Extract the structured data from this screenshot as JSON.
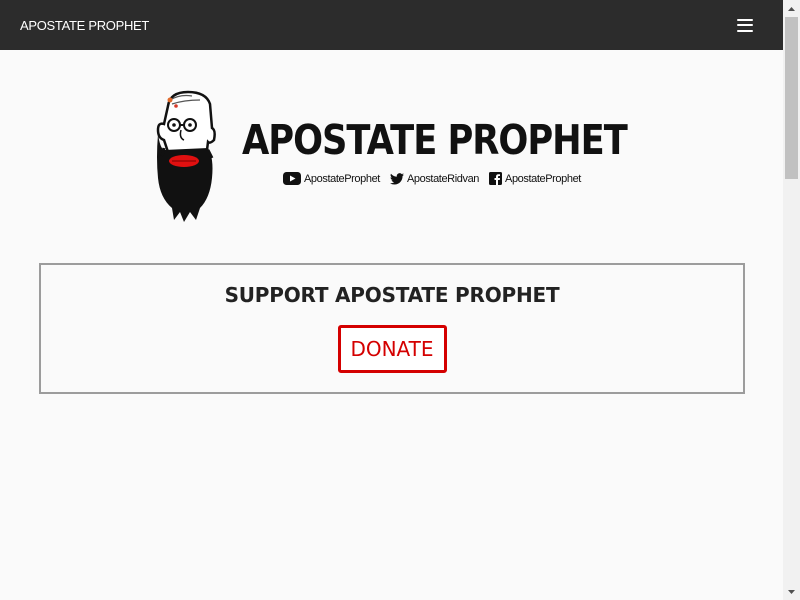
{
  "navbar": {
    "brand": "APOSTATE PROPHET",
    "menu_icon": "hamburger-menu-icon"
  },
  "header": {
    "title": "APOSTATE PROPHET",
    "logo_icon": "bearded-man-caricature-icon",
    "socials": [
      {
        "icon": "youtube-icon",
        "label": "ApostateProphet"
      },
      {
        "icon": "twitter-icon",
        "label": "ApostateRidvan"
      },
      {
        "icon": "facebook-icon",
        "label": "ApostateProphet"
      }
    ]
  },
  "support": {
    "title": "SUPPORT APOSTATE PROPHET",
    "donate_label": "DONATE"
  },
  "colors": {
    "navbar_bg": "#2c2c2c",
    "accent_red": "#d40000",
    "page_bg": "#fafafa",
    "box_border": "#9c9c9c"
  }
}
